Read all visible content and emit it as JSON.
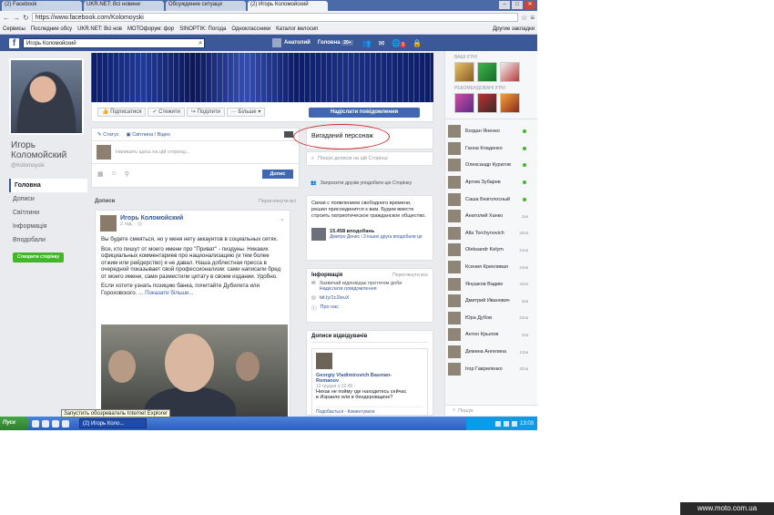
{
  "browser": {
    "tabs": [
      "(2) Facebook",
      "UKR.NET: Всі новини",
      "Обсуждение ситуаци",
      "(2) Игорь Коломойский"
    ],
    "url": "https://www.facebook.com/Kolomoyski",
    "bookmarks": [
      "Сервисы",
      "Последние обсу",
      "UKR.NET: Всі нов",
      "МОТОфорум: фор",
      "SINOPTIK: Погода",
      "Одноклассники",
      "Каталог велосип"
    ],
    "other_bookmarks": "Другие закладки"
  },
  "fb": {
    "search_value": "Игорь Коломойский",
    "user": "Анатолий",
    "home": "Головна",
    "home_count": "20+",
    "notif_count": "1"
  },
  "profile": {
    "name": "Игорь Коломойский",
    "username": "@Kolomoyski",
    "nav": [
      "Головна",
      "Дописи",
      "Світлини",
      "Інформація",
      "Вподобали"
    ],
    "create_page": "Створити сторінку"
  },
  "actions": {
    "subscribe": "Підписатися",
    "liked": "Стежити",
    "share": "Поділити",
    "more": "Більше",
    "send_message": "Надіслати повідомлення"
  },
  "composer": {
    "status": "Статус",
    "photo": "Світлина / Відео",
    "placeholder": "Напишіть щось на цій сторінці...",
    "post": "Допис"
  },
  "posts": {
    "header": "Дописи",
    "view_all": "Переглянути всі",
    "author": "Игорь Коломойский",
    "time": "2 год. ·",
    "p1": "Вы будете смеяться, но у меня нету аккаунтов в социальных сетях.",
    "p2": "Все, кто пишут от моего имени про \"Приват\" - пиздуны. Никаких официальных комментариев про национализацию (и тем более отжим или рейдерство) я не давал. Наша доблестная пресса в очередной показывает свой профессионализм: сами написали бред от моего имени, сами разместили цитату в своем издании. Удобно.",
    "p3": "Если хотите узнать позицию банка, почитайте Дубилета или Гороховского. ...",
    "more": "Показати більше..."
  },
  "right_mid": {
    "nickname": "Вигаданий персонаж",
    "search_placeholder": "Пошук дописів на цій Сторінці",
    "invite": "Запросити друзів уподобати цю Сторінку",
    "about": "Связи с появлением свободного времени, решил присоединится к вам. Будем вместе строить патриотическое гражданское общество.",
    "likes_count": "15.458 вподобань",
    "likes_sub": "Дмитро Денис і 3 інших друга вподобали це",
    "info_header": "Інформація",
    "info_view": "Переглянути все",
    "reply_time": "Зазвичай відповідає протягом доби",
    "send_msg": "Надіслати повідомлення",
    "link": "bit.ly/1c2leuX",
    "about_us": "Про нас",
    "visitors_header": "Дописи відвідувачів",
    "visitor_name": "Georgiy Vladimirovich Basman-Romanov",
    "visitor_time": "12 грудня о 22:45 ·",
    "visitor_text": "Нихак не пойму где находитесь сейчас в Израиле или в бендеровщине?",
    "visitor_actions": "Подобається · Коментувати"
  },
  "sidebar": {
    "games_header": "ВАШІ ІГРИ",
    "rec_header": "РЕКОМЕНДОВАНІ ІГРИ",
    "friends": [
      {
        "name": "Богдан Яненко",
        "status": "online"
      },
      {
        "name": "Ганна Кладенко",
        "status": "online"
      },
      {
        "name": "Олександр Куратов",
        "status": "online"
      },
      {
        "name": "Артем Зубарев",
        "status": "online"
      },
      {
        "name": "Саша Безголосный",
        "status": "online"
      },
      {
        "name": "Анатолий Ханко",
        "status": "4хв"
      },
      {
        "name": "Alla Torchynovich",
        "status": "26хв"
      },
      {
        "name": "Oleksandr Kelym",
        "status": "21хв"
      },
      {
        "name": "Ксения Крихливая",
        "status": "19хв"
      },
      {
        "name": "Янушков Вадим",
        "status": "43хв"
      },
      {
        "name": "Дмитрий Иванович",
        "status": "3хв"
      },
      {
        "name": "Юра Дубов",
        "status": "15хв"
      },
      {
        "name": "Антон Крылов",
        "status": "2хв"
      },
      {
        "name": "Демина Ангелина",
        "status": "13хв"
      },
      {
        "name": "Ігор Гавриленко",
        "status": "32хв"
      }
    ],
    "chat_search": "Пошук"
  },
  "tooltip": "Запустить обозреватель Internet Explorer",
  "taskbar": {
    "start": "Пуск",
    "task": "(2) Игорь Коло...",
    "time": "13:03"
  },
  "watermark": "www.moto.com.ua"
}
